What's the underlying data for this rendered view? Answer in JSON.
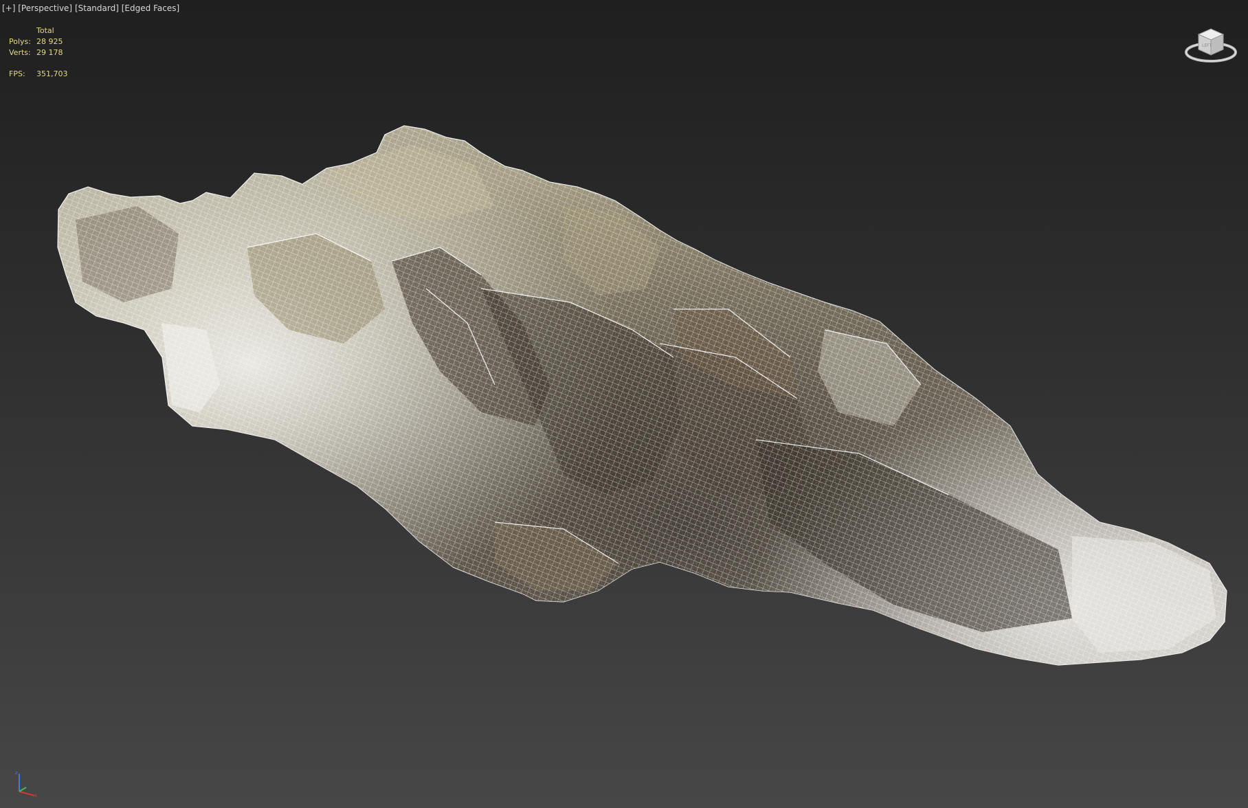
{
  "viewport": {
    "label_parts": [
      "[+]",
      "[Perspective]",
      "[Standard]",
      "[Edged Faces]"
    ],
    "label_colors": {
      "text": "#d8d8d8",
      "stats": "#e3d98a"
    }
  },
  "stats": {
    "header": "Total",
    "polys_label": "Polys:",
    "polys_value": "28 925",
    "verts_label": "Verts:",
    "verts_value": "29 178",
    "fps_label": "FPS:",
    "fps_value": "351,703"
  },
  "scene": {
    "object": "rock-mesh",
    "display_mode": "edged-faces",
    "background": [
      "#1f1f1f",
      "#474747"
    ]
  },
  "icons": {
    "viewcube": "viewcube-icon",
    "axis": "axis-tripod-icon"
  }
}
